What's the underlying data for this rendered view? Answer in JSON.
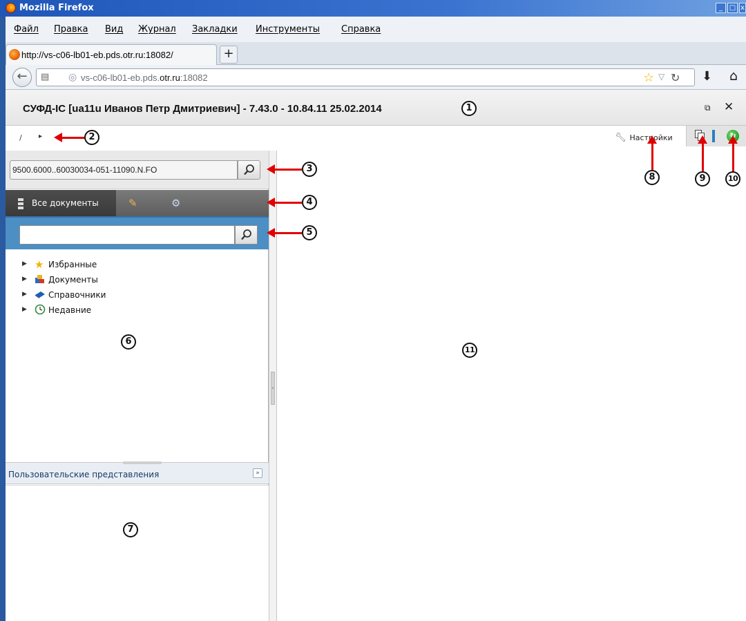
{
  "window": {
    "title": "Mozilla Firefox",
    "controls": [
      "_",
      "□",
      "x"
    ]
  },
  "menubar": {
    "items": [
      "Файл",
      "Правка",
      "Вид",
      "Журнал",
      "Закладки",
      "Инструменты",
      "Справка"
    ]
  },
  "tabs": {
    "active_tab_label": "http://vs-c06-lb01-eb.pds.otr.ru:18082/",
    "new_tab_label": "+"
  },
  "navbar": {
    "url_prefix": "vs-c06-lb01-eb.pds.",
    "url_domain": "otr.ru",
    "url_suffix": ":18082"
  },
  "app": {
    "title": "СУФД-IC [ua11u Иванов Петр Дмитриевич]  - 7.43.0 - 10.84.11 25.02.2014",
    "restore_glyph": "⧉",
    "close_glyph": "✕"
  },
  "breadcrumb": {
    "root": "/",
    "separator": "▸"
  },
  "toolbar": {
    "settings_label": "Настройки",
    "refresh_glyph": "↻"
  },
  "left_panel": {
    "quick_search_value": "9500.6000..60030034-051-11090.N.FO",
    "tabs": {
      "all_documents_label": "Все документы",
      "edit_icon": "edit-icon",
      "settings_icon": "gear-icon"
    },
    "tree_search_value": "",
    "tree": [
      {
        "label": "Избранные",
        "icon": "star-icon"
      },
      {
        "label": "Документы",
        "icon": "documents-icon"
      },
      {
        "label": "Справочники",
        "icon": "book-icon"
      },
      {
        "label": "Недавние",
        "icon": "clock-icon"
      }
    ],
    "user_views_title": "Пользовательские представления"
  },
  "annotations": {
    "c1": "1",
    "c2": "2",
    "c3": "3",
    "c4": "4",
    "c5": "5",
    "c6": "6",
    "c7": "7",
    "c8": "8",
    "c9": "9",
    "c10": "10",
    "c11": "11"
  },
  "colors": {
    "titlebar": "#1f56b8",
    "nav_tabs_bg": "#5e5e5e",
    "tree_search_bg": "#4b8fc4",
    "annotation_arrow": "#e00000"
  }
}
